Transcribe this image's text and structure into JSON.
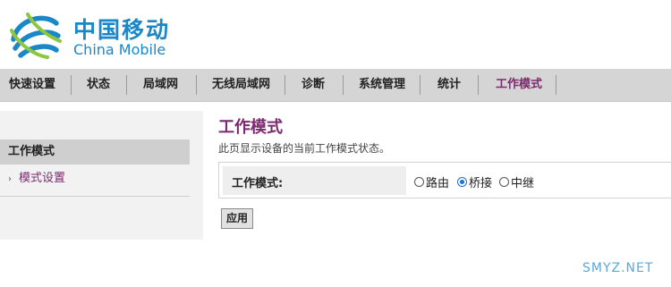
{
  "brand": {
    "logo_icon": "china-mobile-swirl-icon",
    "name_cn": "中国移动",
    "name_en": "China Mobile",
    "color": "#1a87c8"
  },
  "nav": {
    "items": [
      {
        "label": "快速设置",
        "active": false
      },
      {
        "label": "状态",
        "active": false
      },
      {
        "label": "局域网",
        "active": false
      },
      {
        "label": "无线局域网",
        "active": false
      },
      {
        "label": "诊断",
        "active": false
      },
      {
        "label": "系统管理",
        "active": false
      },
      {
        "label": "统计",
        "active": false
      },
      {
        "label": "工作模式",
        "active": true
      }
    ],
    "active_color": "#7b2a6e"
  },
  "sidebar": {
    "heading": "工作模式",
    "items": [
      {
        "label": "模式设置",
        "bullet": "›"
      }
    ]
  },
  "main": {
    "title": "工作模式",
    "description": "此页显示设备的当前工作模式状态。",
    "form": {
      "label": "工作模式:",
      "options": [
        {
          "label": "路由",
          "selected": false
        },
        {
          "label": "桥接",
          "selected": true
        },
        {
          "label": "中继",
          "selected": false
        }
      ]
    },
    "apply_label": "应用"
  },
  "watermark": "SMYZ.NET"
}
